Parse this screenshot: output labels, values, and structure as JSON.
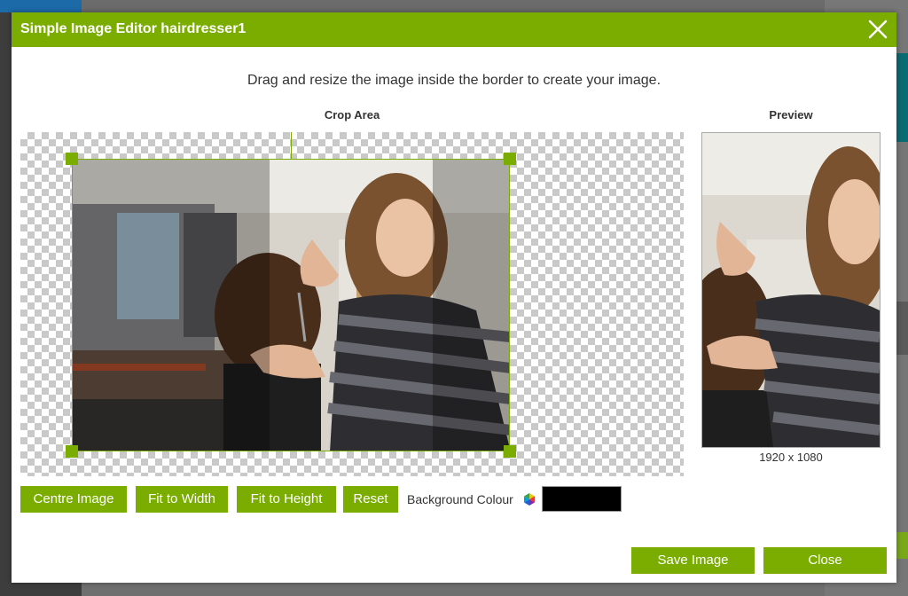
{
  "dialog": {
    "title": "Simple Image Editor hairdresser1",
    "close_icon": "close-icon",
    "instruction": "Drag and resize the image inside the border to create your image.",
    "crop_area_label": "Crop Area",
    "preview_label": "Preview",
    "preview_dimensions": "1920 x 1080"
  },
  "toolbar": {
    "centre_label": "Centre Image",
    "fit_width_label": "Fit to Width",
    "fit_height_label": "Fit to Height",
    "reset_label": "Reset",
    "background_colour_label": "Background Colour",
    "background_colour_value": "#000000",
    "palette_icon": "color-palette-icon"
  },
  "footer": {
    "save_label": "Save Image",
    "close_label": "Close"
  },
  "colors": {
    "accent": "#7aad00",
    "title_text": "#ffffff"
  }
}
